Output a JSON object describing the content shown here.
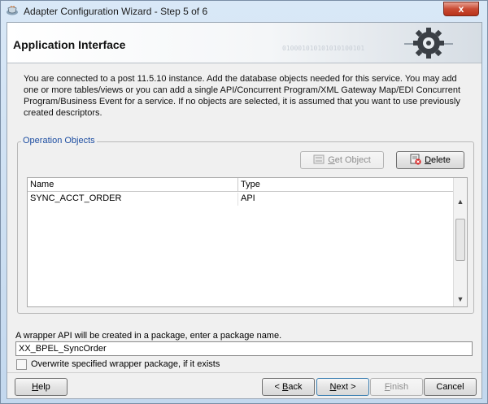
{
  "window": {
    "title": "Adapter Configuration Wizard - Step 5 of 6",
    "close_label": "x"
  },
  "header": {
    "title": "Application Interface",
    "decoration_binary": "010001010101010100101"
  },
  "description_lines": [
    "You are connected to a post 11.5.10 instance. Add the database objects needed for this service. You may add",
    "one or more tables/views or you can add a single API/Concurrent Program/XML Gateway Map/EDI Concurrent",
    "Program/Business Event for a service. If no objects are selected, it is assumed that you want to use previously",
    "created descriptors."
  ],
  "operation_objects": {
    "legend": "Operation Objects",
    "get_object_label_first": "G",
    "get_object_label_rest": "et Object",
    "delete_label_first": "D",
    "delete_label_rest": "elete",
    "columns": [
      "Name",
      "Type"
    ],
    "rows": [
      {
        "name": "SYNC_ACCT_ORDER",
        "type": "API"
      }
    ]
  },
  "package": {
    "label": "A wrapper API will be created in a package, enter a package name.",
    "value": "XX_BPEL_SyncOrder",
    "overwrite_label": "Overwrite specified wrapper package, if it exists"
  },
  "footer": {
    "help_first": "H",
    "help_rest": "elp",
    "back_prefix": "< ",
    "back_first": "B",
    "back_rest": "ack",
    "next_first": "N",
    "next_rest": "ext >",
    "finish_first": "F",
    "finish_rest": "inish",
    "cancel_label": "Cancel"
  }
}
